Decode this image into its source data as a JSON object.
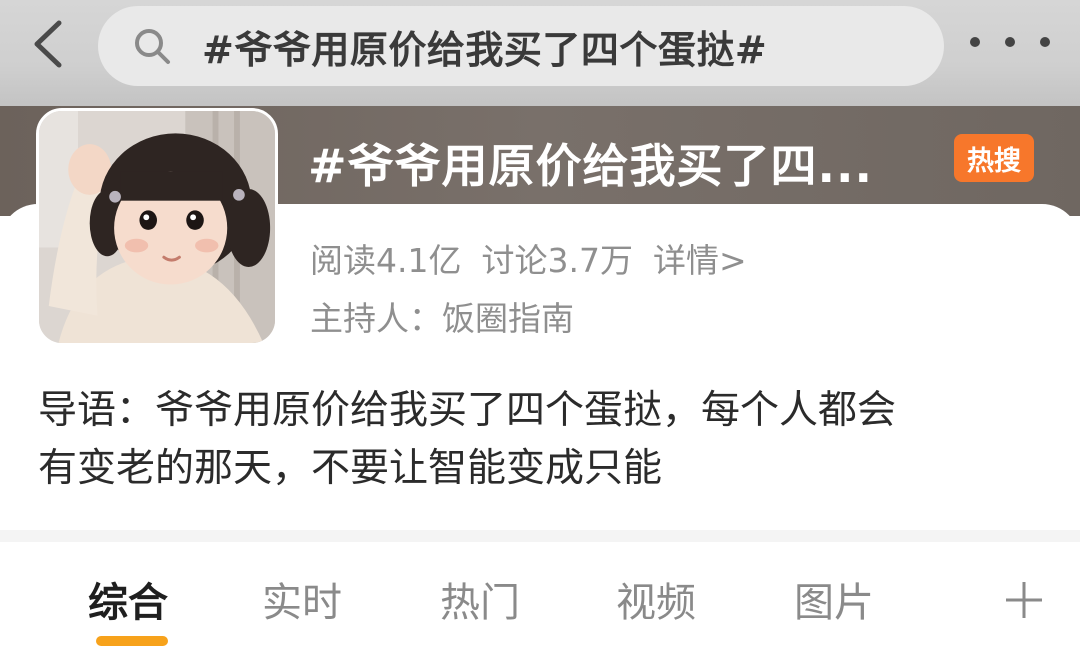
{
  "top_bar": {
    "search_query": "#爷爷用原价给我买了四个蛋挞#"
  },
  "topic": {
    "title": "#爷爷用原价给我买了四...",
    "badge": "热搜",
    "stats": {
      "reads": "阅读4.1亿",
      "discussions": "讨论3.7万",
      "details": "详情>"
    },
    "host_label": "主持人：",
    "host_name": "饭圈指南",
    "intro_line1": "导语：爷爷用原价给我买了四个蛋挞，每个人都会",
    "intro_line2": "有变老的那天，不要让智能变成只能"
  },
  "tabs": [
    {
      "label": "综合",
      "active": true
    },
    {
      "label": "实时",
      "active": false
    },
    {
      "label": "热门",
      "active": false
    },
    {
      "label": "视频",
      "active": false
    },
    {
      "label": "图片",
      "active": false
    }
  ],
  "colors": {
    "badge_bg": "#f7772b",
    "tab_indicator": "#f7a21b",
    "header_band": "#6c625b"
  }
}
